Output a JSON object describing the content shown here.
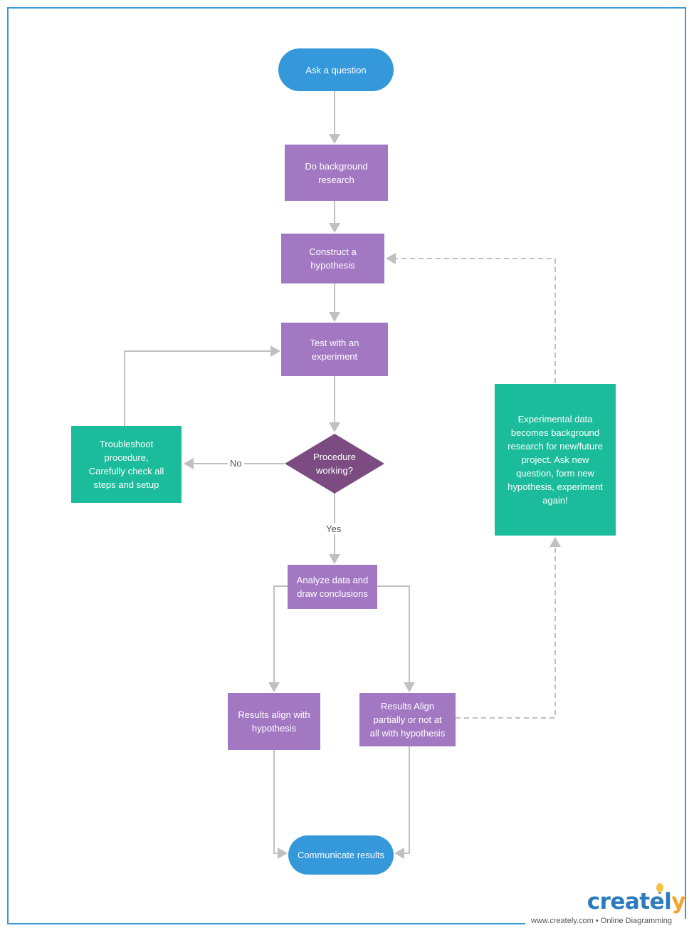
{
  "diagram": {
    "nodes": {
      "ask_question": "Ask a question",
      "background_research": [
        "Do background",
        "research"
      ],
      "construct_hypothesis": [
        "Construct a",
        "hypothesis"
      ],
      "test_experiment": [
        "Test with an",
        "experiment"
      ],
      "procedure_working": [
        "Procedure",
        "working?"
      ],
      "troubleshoot": [
        "Troubleshoot",
        "procedure,",
        "Carefully check all",
        "steps and setup"
      ],
      "analyze_data": [
        "Analyze data and",
        "draw conclusions"
      ],
      "results_align": [
        "Results align with",
        "hypothesis"
      ],
      "results_partial": [
        "Results Align",
        "partially or not at",
        "all with hypothesis"
      ],
      "experimental_data": [
        "Experimental data",
        "becomes background",
        "research for new/future",
        "project. Ask new",
        "question, form new",
        "hypothesis, experiment",
        "again!"
      ],
      "communicate_results": "Communicate results"
    },
    "edge_labels": {
      "no": "No",
      "yes": "Yes"
    },
    "colors": {
      "terminal": "#3498db",
      "process": "#a378c3",
      "decision": "#7b4b82",
      "note": "#1bbc9b",
      "connector": "#c0c0c0",
      "frame": "#3a9ad9"
    }
  },
  "branding": {
    "logo_main": "createl",
    "logo_accent": "y",
    "tagline": "www.creately.com • Online Diagramming"
  }
}
